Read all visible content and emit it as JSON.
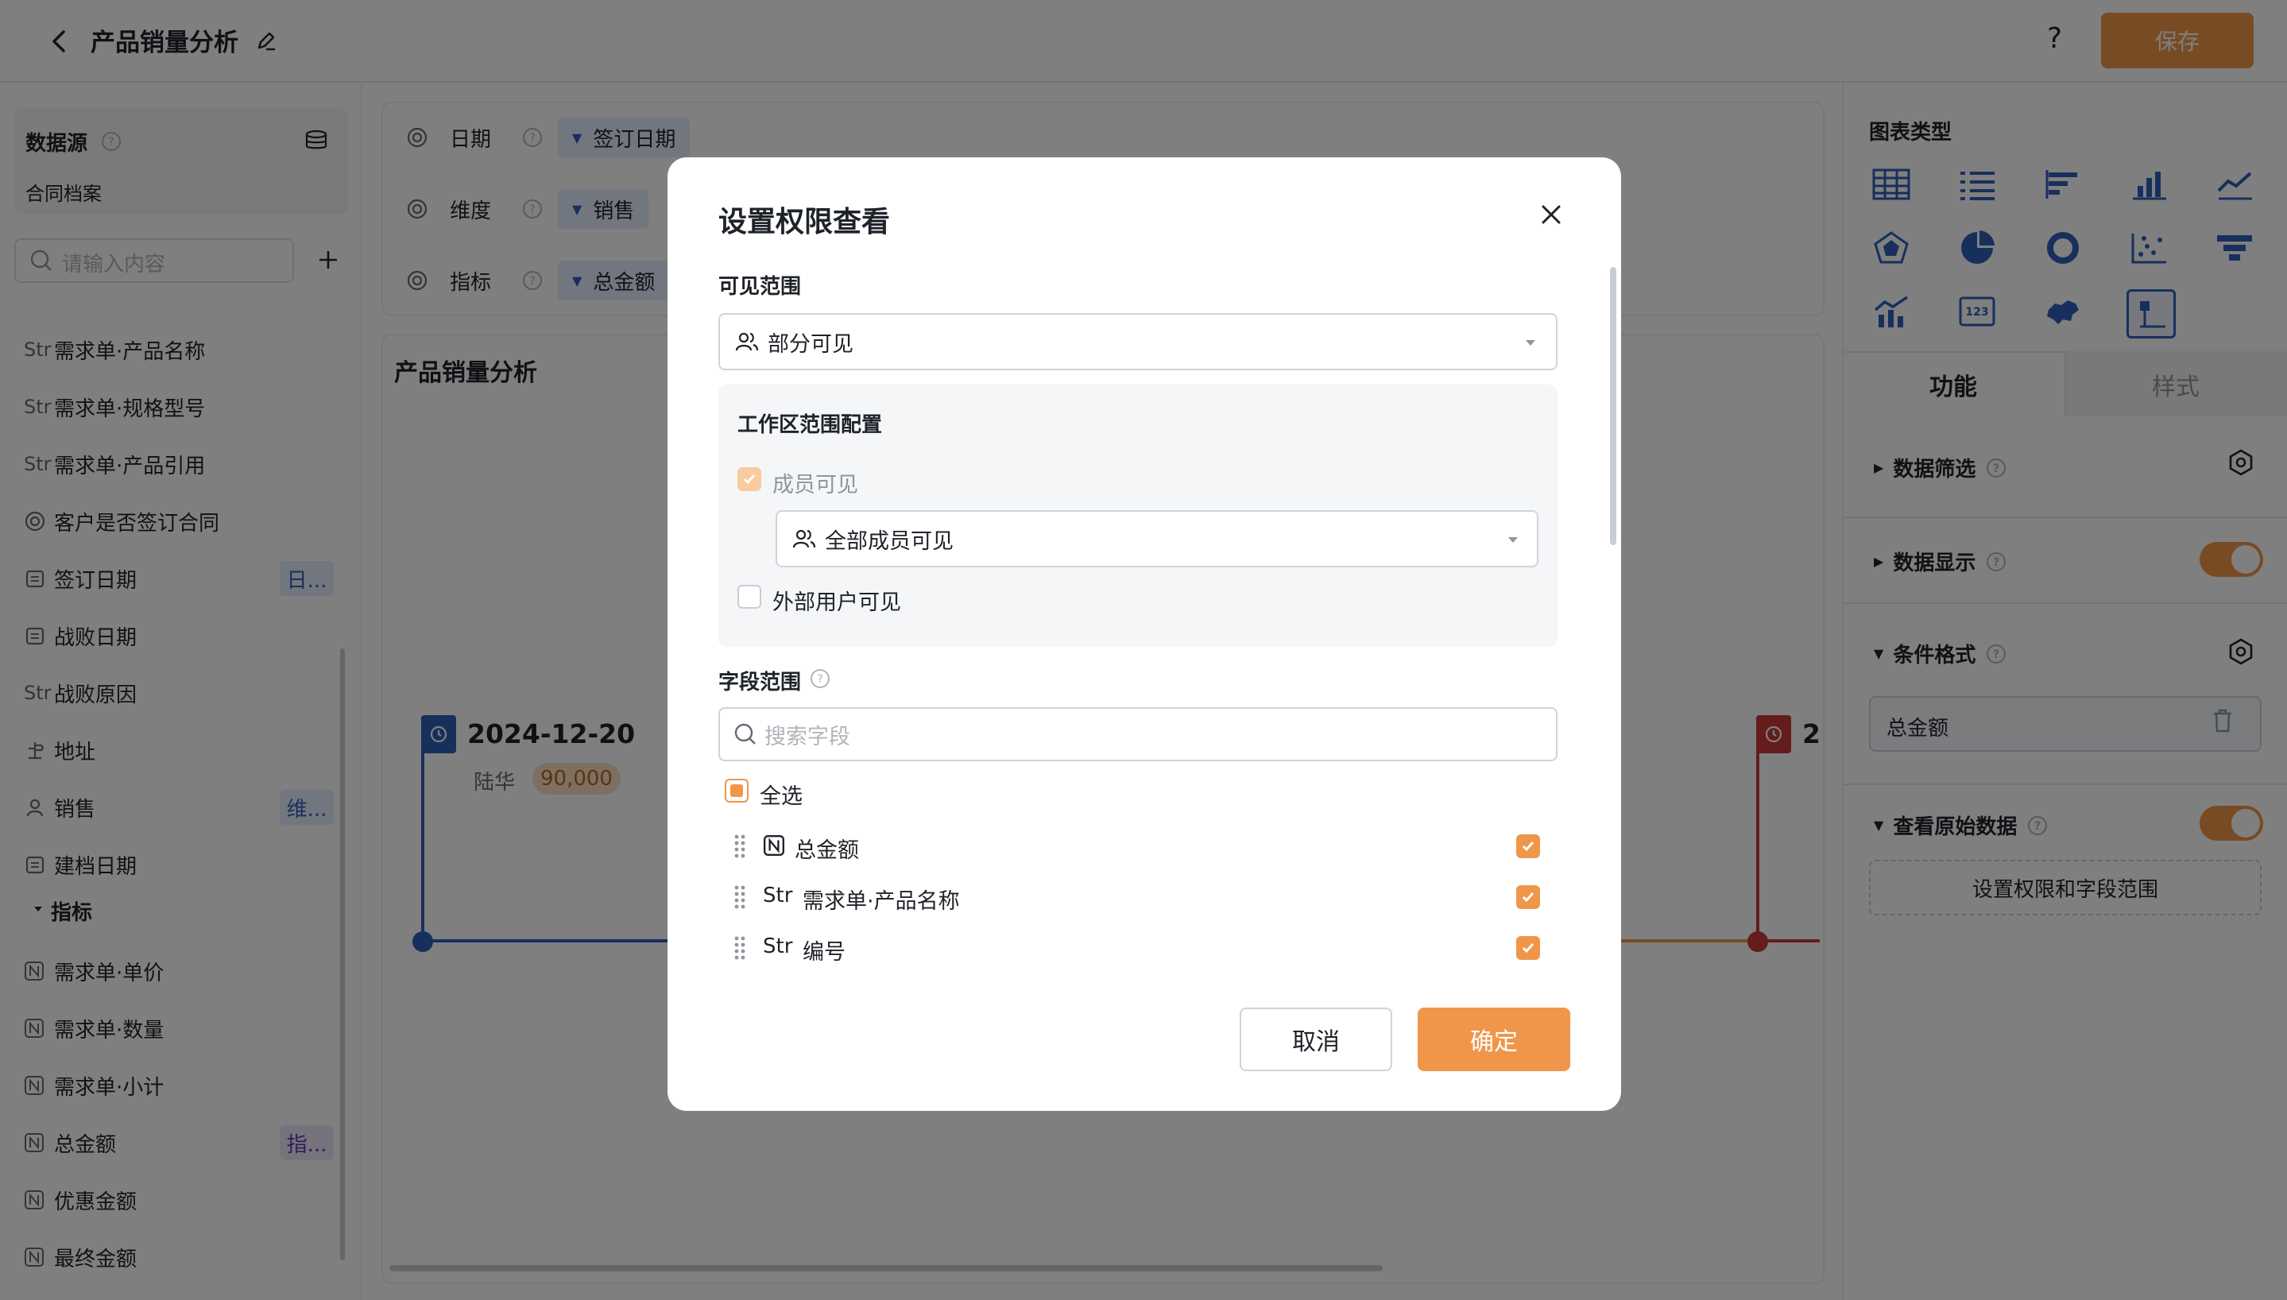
{
  "header": {
    "title": "产品销量分析",
    "help_label": "?",
    "save_label": "保存"
  },
  "left": {
    "datasource_label": "数据源",
    "datasource_name": "合同档案",
    "search_placeholder": "请输入内容",
    "fields": [
      {
        "prefix": "Str",
        "label": "需求单·产品名称",
        "tag": ""
      },
      {
        "prefix": "Str",
        "label": "需求单·规格型号",
        "tag": ""
      },
      {
        "prefix": "Str",
        "label": "需求单·产品引用",
        "tag": ""
      },
      {
        "prefix": "",
        "label": "客户是否签订合同",
        "tag": ""
      },
      {
        "prefix": "",
        "label": "签订日期",
        "tag": "日..."
      },
      {
        "prefix": "",
        "label": "战败日期",
        "tag": ""
      },
      {
        "prefix": "Str",
        "label": "战败原因",
        "tag": ""
      },
      {
        "prefix": "",
        "label": "地址",
        "tag": ""
      },
      {
        "prefix": "",
        "label": "销售",
        "tag": "维..."
      },
      {
        "prefix": "",
        "label": "建档日期",
        "tag": ""
      }
    ],
    "metrics_header": "指标",
    "metrics": [
      {
        "label": "需求单·单价",
        "tag": ""
      },
      {
        "label": "需求单·数量",
        "tag": ""
      },
      {
        "label": "需求单·小计",
        "tag": ""
      },
      {
        "label": "总金额",
        "tag": "指..."
      },
      {
        "label": "优惠金额",
        "tag": ""
      },
      {
        "label": "最终金额",
        "tag": ""
      }
    ]
  },
  "config": {
    "rows": [
      {
        "label": "日期",
        "value": "签订日期"
      },
      {
        "label": "维度",
        "value": "销售"
      },
      {
        "label": "指标",
        "value": "总金额"
      }
    ]
  },
  "chart": {
    "title": "产品销量分析",
    "event_left": {
      "date": "2024-12-20",
      "name": "陆华",
      "amount": "90,000"
    },
    "event_right": {
      "date_fragment": "2"
    }
  },
  "right": {
    "chart_type_label": "图表类型",
    "tabs": [
      "功能",
      "样式"
    ],
    "sections": {
      "filter": "数据筛选",
      "display": "数据显示",
      "cond_format": "条件格式",
      "cond_field": "总金额",
      "raw": "查看原始数据",
      "perm_button": "设置权限和字段范围"
    }
  },
  "modal": {
    "title": "设置权限查看",
    "visible_scope_label": "可见范围",
    "visible_scope_value": "部分可见",
    "workspace_label": "工作区范围配置",
    "member_visible": "成员可见",
    "member_scope_value": "全部成员可见",
    "external_visible": "外部用户可见",
    "field_scope_label": "字段范围",
    "field_search_placeholder": "搜索字段",
    "select_all": "全选",
    "fields": [
      {
        "prefix": "",
        "label": "总金额"
      },
      {
        "prefix": "Str",
        "label": "需求单·产品名称"
      },
      {
        "prefix": "Str",
        "label": "编号"
      }
    ],
    "cancel": "取消",
    "ok": "确定"
  },
  "colors": {
    "accent": "#f0964a",
    "blue": "#2e5fb8",
    "red": "#c8383a"
  }
}
